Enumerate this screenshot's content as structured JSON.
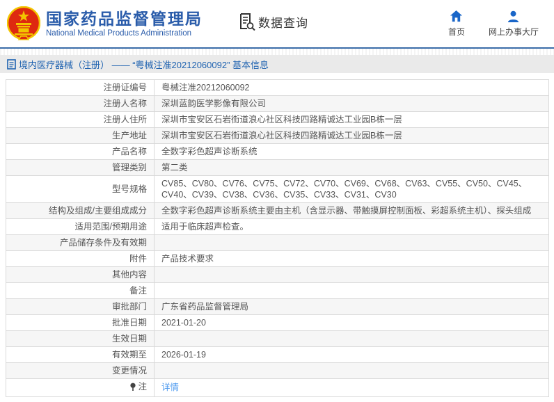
{
  "header": {
    "org_name_cn": "国家药品监督管理局",
    "org_name_en": "National Medical Products Administration",
    "section_title": "数据查询",
    "nav": [
      {
        "label": "首页",
        "icon": "home-icon"
      },
      {
        "label": "网上办事大厅",
        "icon": "user-icon"
      }
    ]
  },
  "breadcrumb": {
    "text": "境内医疗器械（注册） —— “粤械注准20212060092” 基本信息"
  },
  "table": {
    "rows": [
      {
        "label": "注册证编号",
        "value": "粤械注准20212060092"
      },
      {
        "label": "注册人名称",
        "value": "深圳蓝韵医学影像有限公司"
      },
      {
        "label": "注册人住所",
        "value": "深圳市宝安区石岩街道浪心社区科技四路精诚达工业园B栋一层"
      },
      {
        "label": "生产地址",
        "value": "深圳市宝安区石岩街道浪心社区科技四路精诚达工业园B栋一层"
      },
      {
        "label": "产品名称",
        "value": "全数字彩色超声诊断系统"
      },
      {
        "label": "管理类别",
        "value": "第二类"
      },
      {
        "label": "型号规格",
        "value": "CV85、CV80、CV76、CV75、CV72、CV70、CV69、CV68、CV63、CV55、CV50、CV45、CV40、CV39、CV38、CV36、CV35、CV33、CV31、CV30"
      },
      {
        "label": "结构及组成/主要组成成分",
        "value": "全数字彩色超声诊断系统主要由主机（含显示器、带触摸屏控制面板、彩超系统主机）、探头组成"
      },
      {
        "label": "适用范围/预期用途",
        "value": "适用于临床超声检查。"
      },
      {
        "label": "产品储存条件及有效期",
        "value": ""
      },
      {
        "label": "附件",
        "value": "产品技术要求"
      },
      {
        "label": "其他内容",
        "value": ""
      },
      {
        "label": "备注",
        "value": ""
      },
      {
        "label": "审批部门",
        "value": "广东省药品监督管理局"
      },
      {
        "label": "批准日期",
        "value": "2021-01-20"
      },
      {
        "label": "生效日期",
        "value": ""
      },
      {
        "label": "有效期至",
        "value": "2026-01-19"
      },
      {
        "label": "变更情况",
        "value": ""
      },
      {
        "label": "注",
        "value": "详情"
      }
    ]
  },
  "colors": {
    "brand_blue": "#2a5caa",
    "icon_blue": "#1a66c8",
    "link_blue": "#4d9aef",
    "divider_blue": "#3a6ca8",
    "breadcrumb_bg": "#eaeaea",
    "row_alt_bg": "#f6f6f6",
    "border_gray": "#d9d9d9",
    "emblem_red": "#de2910",
    "emblem_gold": "#f2c500"
  }
}
